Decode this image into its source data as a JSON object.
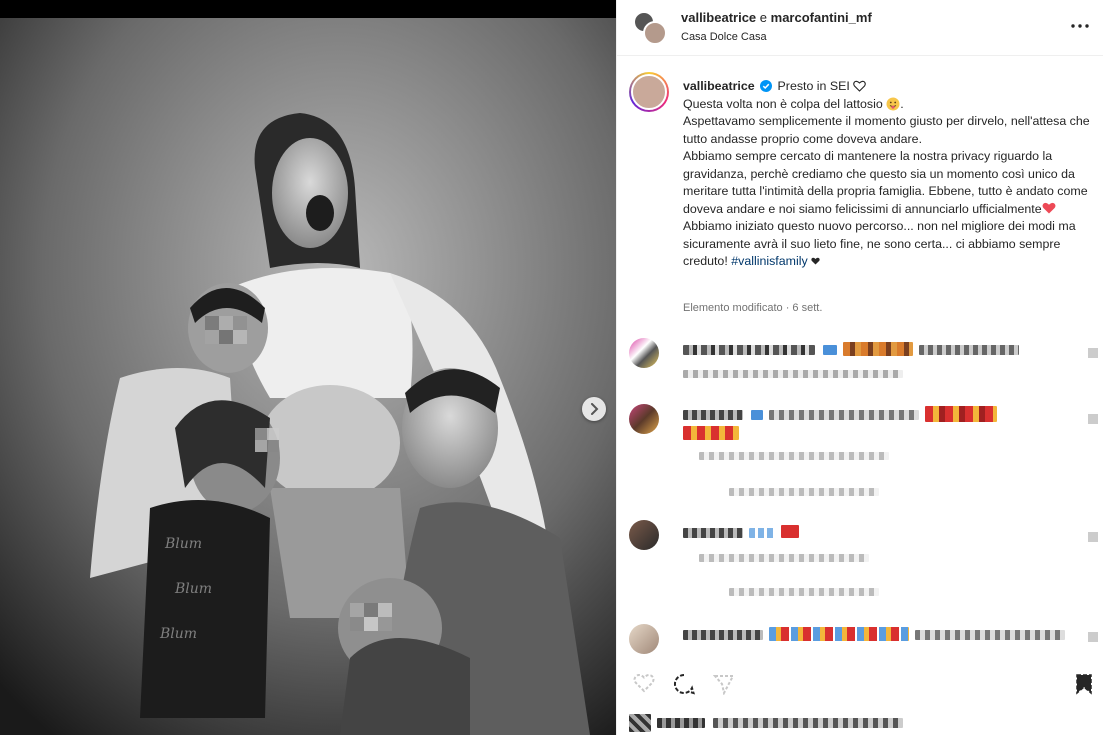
{
  "header": {
    "user1": "vallibeatrice",
    "conjunction": "e",
    "user2": "marcofantini_mf",
    "location": "Casa Dolce Casa"
  },
  "caption": {
    "username": "vallibeatrice",
    "line1": "Presto in SEI",
    "line2": "Questa volta non è colpa del lattosio",
    "line3": "Aspettavamo semplicemente il momento giusto per dirvelo, nell'attesa che tutto andasse proprio come doveva andare.",
    "line4": "Abbiamo sempre cercato di mantenere la nostra privacy riguardo la gravidanza, perchè crediamo che questo sia un momento così unico da meritare tutta l'intimità della propria famiglia. Ebbene, tutto è andato come doveva andare e noi siamo felicissimi di annunciarlo ufficialmente",
    "line5": "Abbiamo iniziato questo nuovo percorso... non nel migliore dei modi ma sicuramente avrà il suo lieto fine, ne sono certa... ci abbiamo sempre creduto!",
    "hashtag": "#vallinisfamily",
    "meta": "Elemento modificato · 6 sett."
  },
  "icons": {
    "verified": "verified-badge-icon",
    "more": "more-options-icon",
    "next": "chevron-right-icon",
    "like": "heart-icon",
    "comment": "comment-icon",
    "share": "share-icon",
    "save": "bookmark-icon"
  },
  "colors": {
    "verified": "#0095f6",
    "heart_red": "#ed4956",
    "hashtag": "#00376b",
    "meta_gray": "#737373"
  }
}
